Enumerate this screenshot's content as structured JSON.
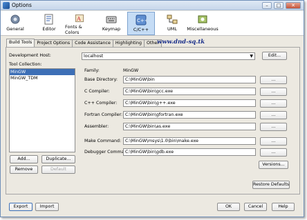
{
  "window": {
    "title": "Options"
  },
  "categories": [
    {
      "label": "General",
      "icon": "general-icon"
    },
    {
      "label": "Editor",
      "icon": "editor-icon"
    },
    {
      "label": "Fonts & Colors",
      "icon": "fonts-colors-icon"
    },
    {
      "label": "Keymap",
      "icon": "keymap-icon"
    },
    {
      "label": "C/C++",
      "icon": "cpp-icon",
      "selected": true
    },
    {
      "label": "UML",
      "icon": "uml-icon"
    },
    {
      "label": "Miscellaneous",
      "icon": "miscellaneous-icon"
    }
  ],
  "tabs": [
    {
      "label": "Build Tools",
      "active": true
    },
    {
      "label": "Project Options"
    },
    {
      "label": "Code Assistance"
    },
    {
      "label": "Highlighting"
    },
    {
      "label": "Other"
    }
  ],
  "watermark": "www.dnd-sq.tk",
  "dev_host": {
    "label": "Development Host:",
    "value": "localhost",
    "edit_button": "Edit..."
  },
  "tool_collection": {
    "label": "Tool Collection:",
    "items": [
      {
        "label": "MinGW",
        "selected": true
      },
      {
        "label": "MinGW_TDM"
      }
    ],
    "buttons": {
      "add": "Add...",
      "duplicate": "Duplicate...",
      "remove": "Remove",
      "default": "Default"
    }
  },
  "family": {
    "label": "Family:",
    "value": "MinGW"
  },
  "fields": [
    {
      "label": "Base Directory:",
      "value": "C:\\MinGW\\bin"
    },
    {
      "label": "C Compiler:",
      "value": "C:\\MinGW\\bin\\gcc.exe"
    },
    {
      "label": "C++ Compiler:",
      "value": "C:\\MinGW\\bin\\g++.exe"
    },
    {
      "label": "Fortran Compiler:",
      "value": "C:\\MinGW\\bin\\gfortran.exe"
    },
    {
      "label": "Assembler:",
      "value": "C:\\MinGW\\bin\\as.exe"
    },
    {
      "label": "Make Command:",
      "value": "C:\\MinGW\\msys\\1.0\\bin\\make.exe"
    },
    {
      "label": "Debugger Command:",
      "value": "C:\\MinGW\\bin\\gdb.exe"
    }
  ],
  "browse_label": "...",
  "versions_button": "Versions...",
  "restore_defaults_button": "Restore Defaults",
  "footer": {
    "export": "Export",
    "import": "Import",
    "ok": "OK",
    "cancel": "Cancel",
    "help": "Help"
  }
}
